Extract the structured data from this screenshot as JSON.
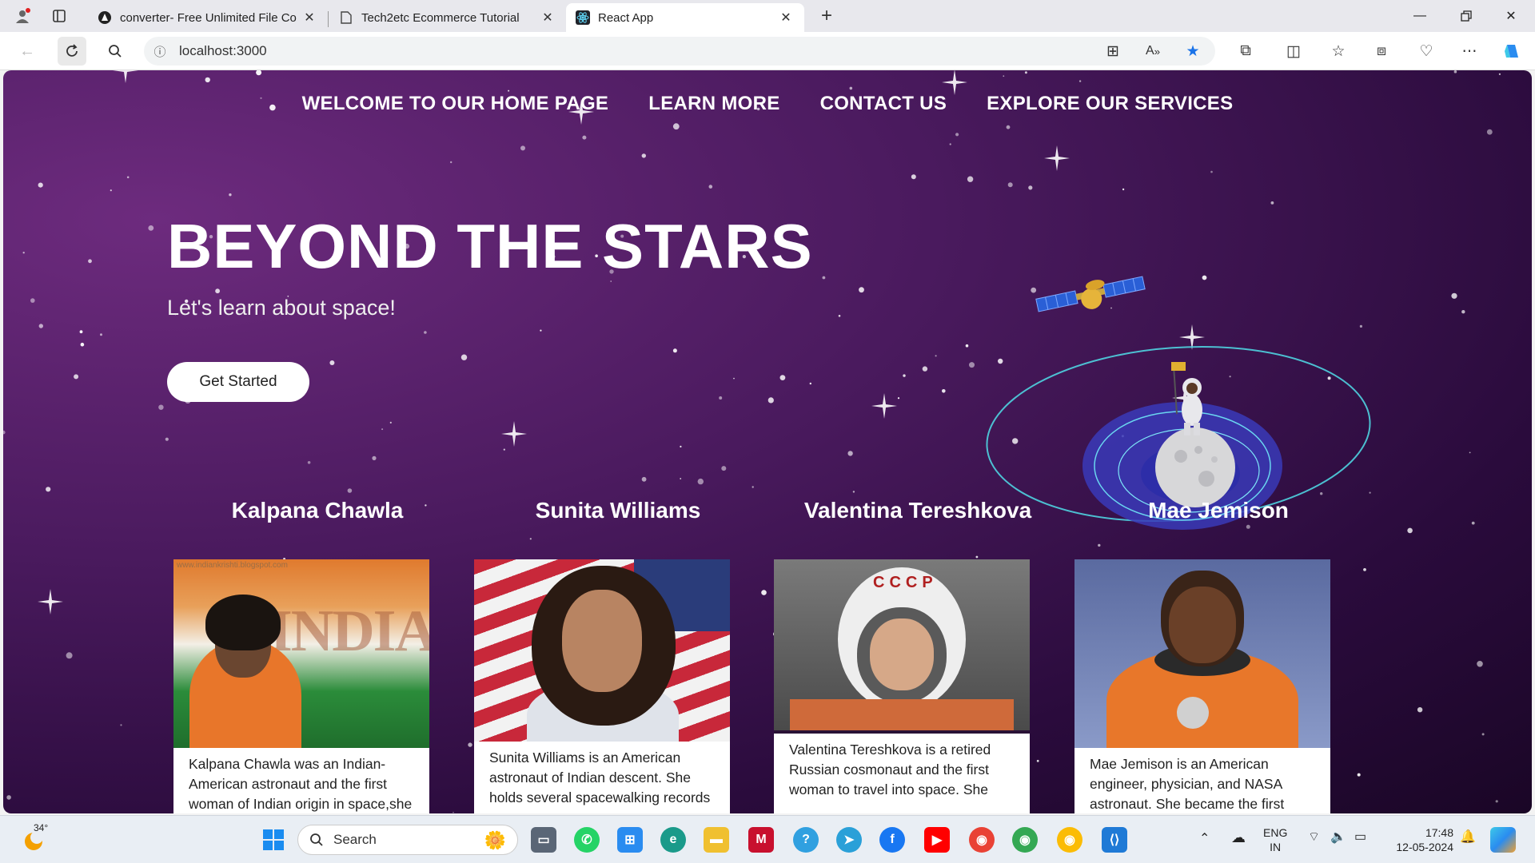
{
  "browser": {
    "tabs": [
      {
        "title": "converter- Free Unlimited File Co",
        "icon": "converter-favicon"
      },
      {
        "title": "Tech2etc Ecommerce Tutorial",
        "icon": "page-icon"
      },
      {
        "title": "React App",
        "icon": "react-icon"
      }
    ],
    "url": "localhost:3000"
  },
  "page": {
    "nav": [
      "WELCOME TO OUR HOME PAGE",
      "LEARN MORE",
      "CONTACT US",
      "EXPLORE OUR SERVICES"
    ],
    "hero_title": "BEYOND THE STARS",
    "hero_subtitle": "Let's learn about space!",
    "cta": "Get Started",
    "astronauts": [
      {
        "name": "Kalpana Chawla",
        "desc": "Kalpana Chawla was an Indian-American astronaut and the first woman of Indian origin in space,she",
        "watermark": "www.indiankrishti.blogspot.com"
      },
      {
        "name": "Sunita Williams",
        "desc": "Sunita Williams is an American astronaut of Indian descent. She holds several spacewalking records"
      },
      {
        "name": "Valentina Tereshkova",
        "desc": "Valentina Tereshkova is a retired Russian cosmonaut and the first woman to travel into space. She",
        "helmet_text": "CCCP"
      },
      {
        "name": "Mae Jemison",
        "desc": "Mae Jemison is an American engineer, physician, and NASA astronaut. She became the first"
      }
    ]
  },
  "taskbar": {
    "weather": "34°",
    "search": "Search",
    "lang": "ENG",
    "region": "IN",
    "time": "17:48",
    "date": "12-05-2024"
  },
  "colors": {
    "bg_dark": "#2a0b3c",
    "bg_light": "#6d2b7e",
    "accent": "#1a73e8"
  }
}
